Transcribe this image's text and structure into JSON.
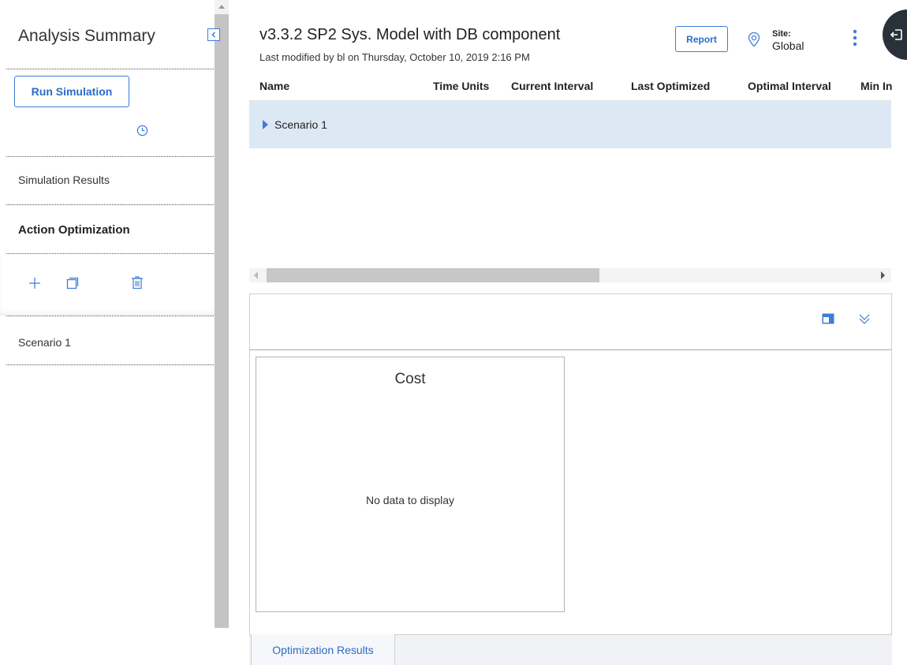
{
  "sidebar": {
    "title": "Analysis Summary",
    "run_simulation_label": "Run Simulation",
    "items": [
      {
        "label": "Simulation Results"
      },
      {
        "label": "Action Optimization"
      },
      {
        "label": "Scenario 1"
      }
    ]
  },
  "header": {
    "title": "v3.3.2 SP2 Sys. Model with DB component",
    "subtitle": "Last modified by bl on Thursday, October 10, 2019 2:16 PM",
    "report_label": "Report",
    "site_label": "Site:",
    "site_value": "Global"
  },
  "grid": {
    "columns": [
      "Name",
      "Time Units",
      "Current Interval",
      "Last Optimized",
      "Optimal Interval",
      "Min In"
    ],
    "rows": [
      {
        "name": "Scenario 1"
      }
    ]
  },
  "chart_panel": {
    "title": "Cost",
    "empty_message": "No data to display"
  },
  "tabs": [
    {
      "label": "Optimization Results"
    }
  ],
  "colors": {
    "accent": "#3b7dd8",
    "row_selected": "#dde8f5"
  }
}
